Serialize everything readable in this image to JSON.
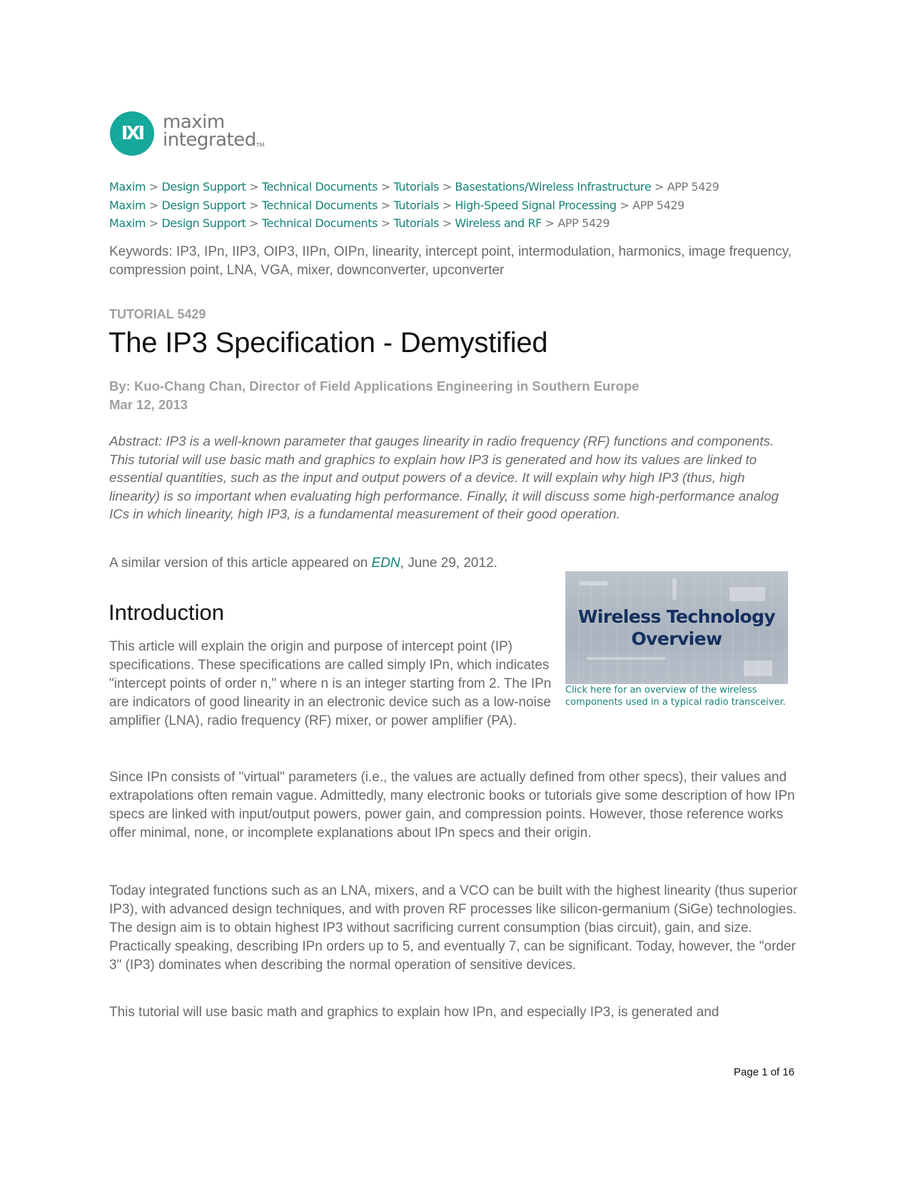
{
  "logo": {
    "mark_glyph": "IXI",
    "line1": "maxim",
    "line2": "integrated",
    "tm": "TM",
    "brand_color": "#14a99b"
  },
  "breadcrumbs": [
    {
      "items": [
        "Maxim",
        "Design Support",
        "Technical Documents",
        "Tutorials",
        "Basestations/Wireless Infrastructure"
      ],
      "current": "APP 5429"
    },
    {
      "items": [
        "Maxim",
        "Design Support",
        "Technical Documents",
        "Tutorials",
        "High-Speed Signal Processing"
      ],
      "current": "APP 5429"
    },
    {
      "items": [
        "Maxim",
        "Design Support",
        "Technical Documents",
        "Tutorials",
        "Wireless and RF"
      ],
      "current": "APP 5429"
    }
  ],
  "breadcrumb_separator": ">",
  "keywords": "Keywords: IP3, IPn, IIP3, OIP3, IIPn, OIPn, linearity, intercept point, intermodulation, harmonics, image frequency, compression point, LNA, VGA, mixer, downconverter, upconverter",
  "article": {
    "label": "TUTORIAL 5429",
    "title": "The IP3 Specification - Demystified",
    "byline": "By: Kuo-Chang Chan, Director of Field Applications Engineering in Southern Europe",
    "date": "Mar 12, 2013",
    "abstract": "Abstract: IP3 is a well-known parameter that gauges linearity in radio frequency (RF) functions and components. This tutorial will use basic math and graphics to explain how IP3 is generated and how its values are linked to essential quantities, such as the input and output powers of a device. It will explain why high IP3 (thus, high linearity) is so important when evaluating high performance. Finally, it will discuss some high-performance analog ICs in which linearity, high IP3, is a fundamental measurement of their good operation.",
    "edn": {
      "prefix": "A similar version of this article appeared on ",
      "link": "EDN",
      "suffix": ", June 29, 2012."
    },
    "intro_heading": "Introduction",
    "paragraphs": [
      "This article will explain the origin and purpose of intercept point (IP) specifications. These specifications are called simply IPn, which indicates \"intercept points of order n,\" where n is an integer starting from 2. The IPn are indicators of good linearity in an electronic device such as a low-noise amplifier (LNA), radio frequency (RF) mixer, or power amplifier (PA).",
      "Since IPn consists of \"virtual\" parameters (i.e., the values are actually defined from other specs), their values and extrapolations often remain vague. Admittedly, many electronic books or tutorials give some description of how IPn specs are linked with input/output powers, power gain, and compression points. However, those reference works offer minimal, none, or incomplete explanations about IPn specs and their origin.",
      "Today integrated functions such as an LNA, mixers, and a VCO can be built with the highest linearity (thus superior IP3), with advanced design techniques, and with proven RF processes like silicon-germanium (SiGe) technologies. The design aim is to obtain highest IP3 without sacrificing current consumption (bias circuit), gain, and size. Practically speaking, describing IPn orders up to 5, and eventually 7, can be significant. Today, however, the \"order 3\" (IP3) dominates when describing the normal operation of sensitive devices.",
      "This tutorial will use basic math and graphics to explain how IPn, and especially IP3, is generated and"
    ]
  },
  "promo": {
    "title_line1": "Wireless Technology",
    "title_line2": "Overview",
    "caption": "Click here for an overview of the wireless components used in a typical radio transceiver."
  },
  "footer": {
    "page": "Page 1 of 16"
  }
}
